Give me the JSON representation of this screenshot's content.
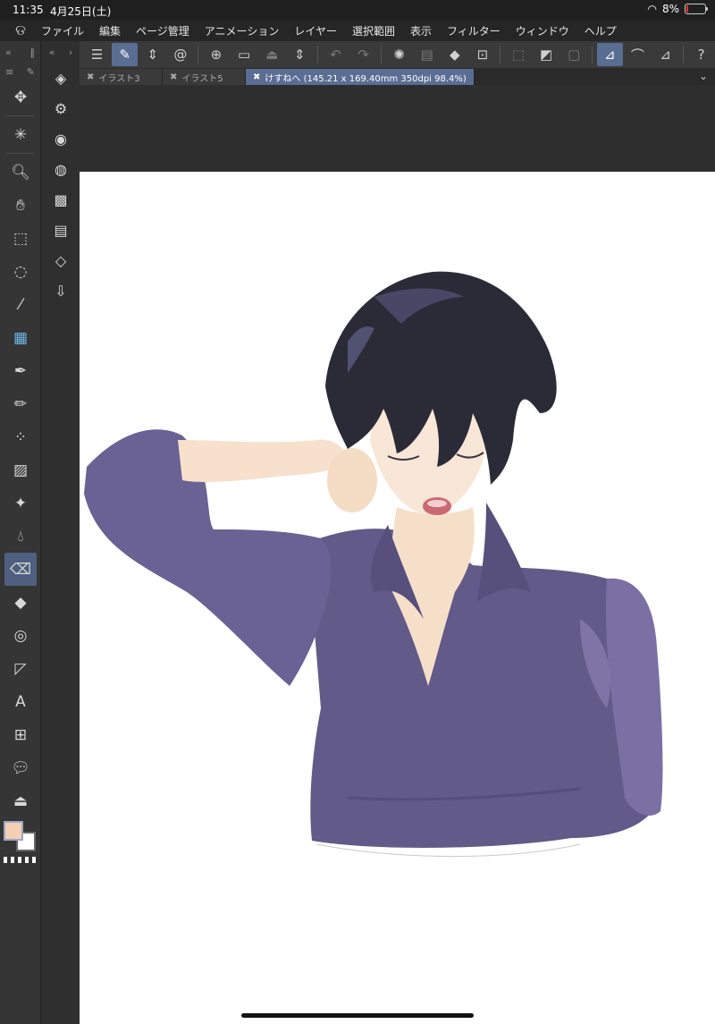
{
  "status": {
    "time": "11:35",
    "date": "4月25日(土)",
    "battery": "8%",
    "battery_fraction": 0.08
  },
  "menu": [
    "ファイル",
    "編集",
    "ページ管理",
    "アニメーション",
    "レイヤー",
    "選択範囲",
    "表示",
    "フィルター",
    "ウィンドウ",
    "ヘルプ"
  ],
  "tabs": [
    {
      "label": "イラスト3",
      "active": false
    },
    {
      "label": "イラスト5",
      "active": false
    },
    {
      "label": "けすねへ (145.21 x 169.40mm 350dpi 98.4%)",
      "active": true
    }
  ],
  "tools": [
    "move-icon",
    "wand-icon",
    "zoom-icon",
    "hand-icon",
    "object-select-icon",
    "lasso-icon",
    "eyedropper-icon",
    "fill-layer-icon",
    "pen-icon",
    "pencil-icon",
    "airbrush-icon",
    "gradient-icon",
    "sparkle-icon",
    "blend-icon",
    "eraser-icon",
    "fill-icon",
    "smudge-icon",
    "ruler-icon",
    "text-icon",
    "frame-icon",
    "balloon-icon",
    "stamp-icon"
  ],
  "subtools": [
    "layer-props-icon",
    "layer-settings-icon",
    "fill-settings-icon",
    "navigator-icon",
    "material-icon",
    "animation-icon",
    "layers-icon",
    "import-icon"
  ],
  "colors": {
    "main": "#f4cfb3",
    "sub": "#ffffff",
    "accent": "#5a6d93",
    "shirt": "#625a88",
    "hair": "#2b2b38"
  }
}
